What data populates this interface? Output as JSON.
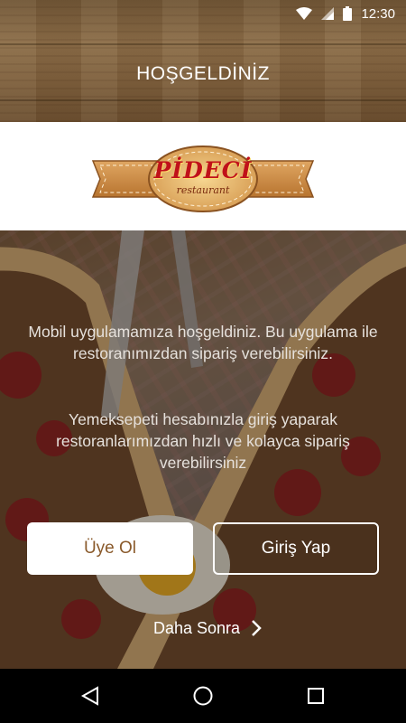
{
  "status_bar": {
    "time": "12:30",
    "icons": [
      "wifi-icon",
      "signal-icon",
      "battery-icon"
    ]
  },
  "header": {
    "title": "HOŞGELDİNİZ"
  },
  "logo": {
    "name": "PİDECİ",
    "subtitle": "restaurant"
  },
  "welcome": {
    "message1": "Mobil uygulamamıza hoşgeldiniz. Bu uygulama ile restoranımızdan sipariş verebilirsiniz.",
    "message2": "Yemeksepeti hesabınızla giriş yaparak restoranlarımızdan hızlı ve kolayca sipariş verebilirsiniz"
  },
  "actions": {
    "register_label": "Üye Ol",
    "login_label": "Giriş Yap",
    "later_label": "Daha Sonra"
  },
  "nav_bar": {
    "icons": [
      "back-icon",
      "home-icon",
      "recent-apps-icon"
    ]
  },
  "colors": {
    "wood": "#7d5f3d",
    "register_text": "#8a5a2b",
    "white": "#ffffff",
    "nav_bg": "#000000"
  }
}
